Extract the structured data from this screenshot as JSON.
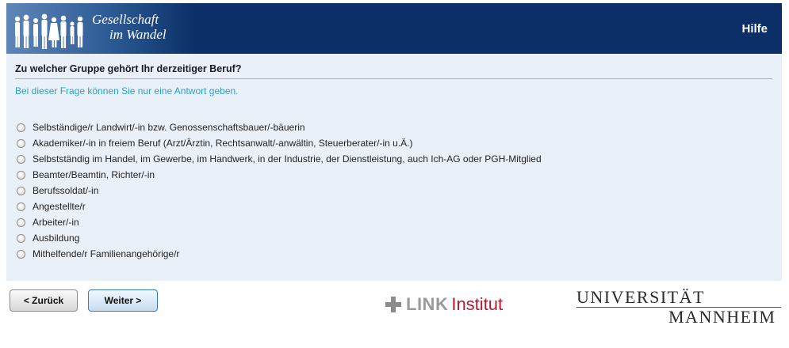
{
  "header": {
    "logo_line1": "Gesellschaft",
    "logo_line2": "im Wandel",
    "help_label": "Hilfe"
  },
  "question": {
    "title": "Zu welcher Gruppe gehört Ihr derzeitiger Beruf?",
    "hint": "Bei dieser Frage können Sie nur eine Antwort geben.",
    "options": [
      "Selbständige/r Landwirt/-in bzw. Genossenschaftsbauer/-bäuerin",
      "Akademiker/-in in freiem Beruf (Arzt/Ärztin, Rechtsanwalt/-anwältin, Steuerberater/-in u.Ä.)",
      "Selbstständig im Handel, im Gewerbe, im Handwerk, in der Industrie, der Dienstleistung, auch Ich-AG oder PGH-Mitglied",
      "Beamter/Beamtin, Richter/-in",
      "Berufssoldat/-in",
      "Angestellte/r",
      "Arbeiter/-in",
      "Ausbildung",
      "Mithelfende/r Familienangehörige/r"
    ]
  },
  "nav": {
    "back_label": "< Zurück",
    "next_label": "Weiter >"
  },
  "logos": {
    "link_bold": "LINK",
    "link_institut": "Institut",
    "uni_top": "UNIVERSITÄT",
    "uni_bottom": "MANNHEIM"
  },
  "colors": {
    "header_bg": "#0b2f66",
    "content_bg": "#eaf0f8",
    "hint_color": "#2aa2c8",
    "link_red": "#b01c2e"
  }
}
